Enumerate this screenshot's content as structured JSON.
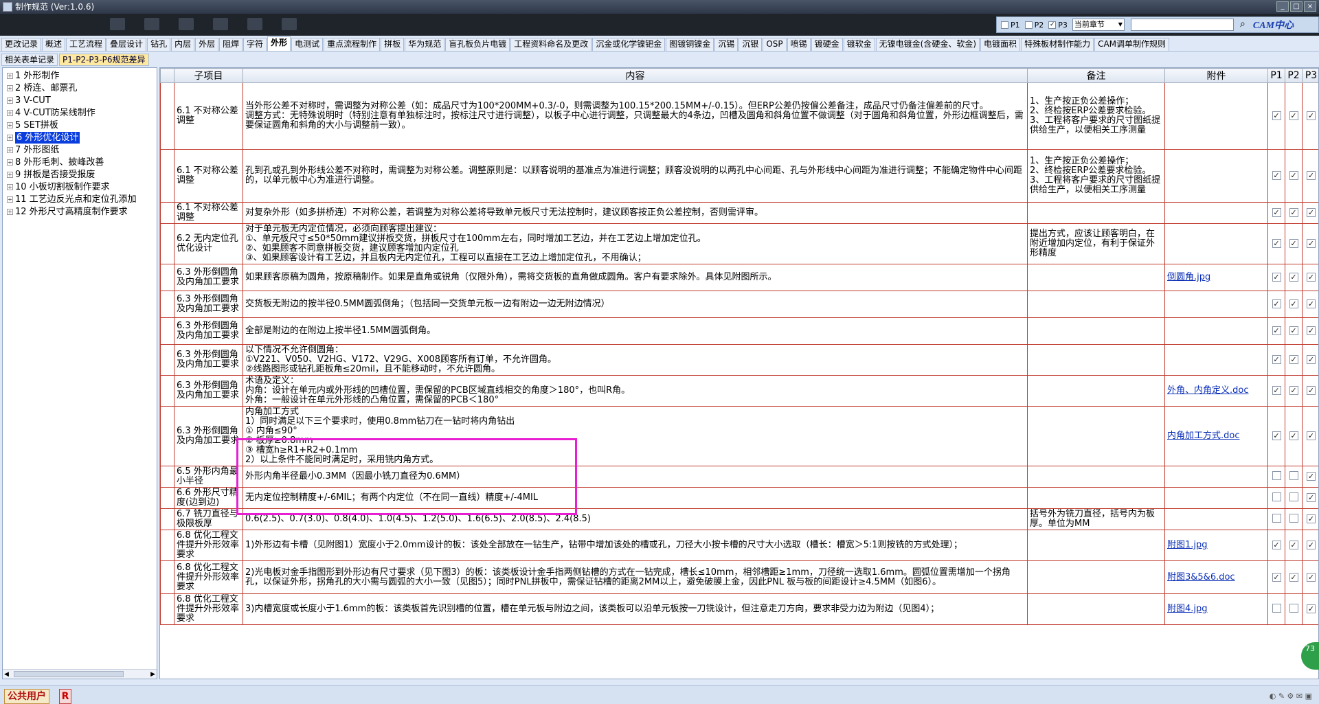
{
  "window": {
    "title": "制作规范 (Ver:1.0.6)"
  },
  "search": {
    "p1_label": "P1",
    "p2_label": "P2",
    "p3_label": "P3",
    "p1_checked": false,
    "p2_checked": false,
    "p3_checked": true,
    "scope": "当前章节",
    "query": "",
    "logo_text": "CAM中心"
  },
  "tabs": [
    "更改记录",
    "概述",
    "工艺流程",
    "叠层设计",
    "钻孔",
    "内层",
    "外层",
    "阻焊",
    "字符",
    "外形",
    "电测试",
    "重点流程制作",
    "拼板",
    "华为规范",
    "盲孔板负片电镀",
    "工程资料命名及更改",
    "沉金或化学镍钯金",
    "图镀铜镍金",
    "沉锡",
    "沉银",
    "OSP",
    "喷锡",
    "镀硬金",
    "镀软金",
    "无镍电镀金(含硬金、软金)",
    "电镀面积",
    "特殊板材制作能力",
    "CAM调单制作规则"
  ],
  "active_tab": "外形",
  "subtabs": [
    "相关表单记录",
    "P1-P2-P3-P6规范差异"
  ],
  "active_subtab": "P1-P2-P3-P6规范差异",
  "tree": [
    "1 外形制作",
    "2 桥连、邮票孔",
    "3 V-CUT",
    "4 V-CUT防呆线制作",
    "5 SET拼板",
    "6 外形优化设计",
    "7 外形图纸",
    "8 外形毛刺、披峰改善",
    "9 拼板是否接受报废",
    "10 小板切割板制作要求",
    "11 工艺边反光点和定位孔添加",
    "12 外形尺寸高精度制作要求"
  ],
  "selected_tree": "6 外形优化设计",
  "columns": {
    "sub": "子项目",
    "content": "内容",
    "note": "备注",
    "attach": "附件",
    "p1": "P1",
    "p2": "P2",
    "p3": "P3"
  },
  "rows": [
    {
      "sub": "6.1 不对称公差调整",
      "content": "当外形公差不对称时，需调整为对称公差（如：成品尺寸为100*200MM+0.3/-0，则需调整为100.15*200.15MM+/-0.15）。但ERP公差仍按偏公差备注，成品尺寸仍备注偏差前的尺寸。\n调整方式：无特殊说明时（特别注意有单独标注时，按标注尺寸进行调整），以板子中心进行调整，只调整最大的4条边，凹槽及圆角和斜角位置不做调整（对于圆角和斜角位置，外形边框调整后，需要保证圆角和斜角的大小与调整前一致）。",
      "note": "1、生产按正负公差操作；\n2、终检按ERP公差要求检验。\n3、工程将客户要求的尺寸图纸提供给生产，以便相关工序测量",
      "attach": "",
      "p1": true,
      "p2": true,
      "p3": true
    },
    {
      "sub": "6.1 不对称公差调整",
      "content": "孔到孔或孔到外形线公差不对称时，需调整为对称公差。调整原则是：以顾客说明的基准点为准进行调整；顾客没说明的以两孔中心间距、孔与外形线中心间距为准进行调整；不能确定物件中心间距的，以单元板中心为准进行调整。",
      "note": "1、生产按正负公差操作；\n2、终检按ERP公差要求检验。\n3、工程将客户要求的尺寸图纸提供给生产，以便相关工序测量",
      "attach": "",
      "p1": true,
      "p2": true,
      "p3": true
    },
    {
      "sub": "6.1 不对称公差调整",
      "content": "对复杂外形（如多拼桥连）不对称公差，若调整为对称公差将导致单元板尺寸无法控制时，建议顾客按正负公差控制，否则需评审。",
      "note": "",
      "attach": "",
      "p1": true,
      "p2": true,
      "p3": true
    },
    {
      "sub": "6.2 无内定位孔优化设计",
      "content": "对于单元板无内定位情况，必须向顾客提出建议：\n①、单元板尺寸≤50*50mm建议拼板交货，拼板尺寸在100mm左右，同时增加工艺边，并在工艺边上增加定位孔。\n②、如果顾客不同意拼板交货，建议顾客增加内定位孔\n③、如果顾客设计有工艺边，并且板内无内定位孔，工程可以直接在工艺边上增加定位孔，不用确认；",
      "note": "提出方式，应该让顾客明白，在附近增加内定位，有利于保证外形精度",
      "attach": "",
      "p1": true,
      "p2": true,
      "p3": true
    },
    {
      "sub": "6.3 外形倒圆角及内角加工要求",
      "content": "如果顾客原稿为圆角，按原稿制作。如果是直角或锐角（仅限外角），需将交货板的直角做成圆角。客户有要求除外。具体见附图所示。",
      "note": "",
      "attach": "倒圆角.jpg",
      "p1": true,
      "p2": true,
      "p3": true
    },
    {
      "sub": "6.3 外形倒圆角及内角加工要求",
      "content": "交货板无附边的按半径0.5MM圆弧倒角；（包括同一交货单元板一边有附边一边无附边情况）",
      "note": "",
      "attach": "",
      "p1": true,
      "p2": true,
      "p3": true
    },
    {
      "sub": "6.3 外形倒圆角及内角加工要求",
      "content": "全部是附边的在附边上按半径1.5MM圆弧倒角。",
      "note": "",
      "attach": "",
      "p1": true,
      "p2": true,
      "p3": true
    },
    {
      "sub": "6.3 外形倒圆角及内角加工要求",
      "content": "以下情况不允许倒圆角：\n①V221、V050、V2HG、V172、V29G、X008顾客所有订单，不允许圆角。\n②线路图形或钻孔距板角≤20mil，且不能移动时，不允许圆角。",
      "note": "",
      "attach": "",
      "p1": true,
      "p2": true,
      "p3": true
    },
    {
      "sub": "6.3 外形倒圆角及内角加工要求",
      "content": "术语及定义：\n内角：设计在单元内或外形线的凹槽位置，需保留的PCB区域直线相交的角度＞180°，也叫R角。\n外角：一般设计在单元外形线的凸角位置，需保留的PCB＜180°",
      "note": "",
      "attach": "外角、内角定义.doc",
      "p1": true,
      "p2": true,
      "p3": true
    },
    {
      "sub": "6.3 外形倒圆角及内角加工要求",
      "content": "内角加工方式\n1）同时满足以下三个要求时，使用0.8mm钻刀在一钻时将内角钻出\n① 内角≤90°\n② 板厚≥0.8mm\n③ 槽宽h≥R1+R2+0.1mm\n2）以上条件不能同时满足时，采用铣内角方式。",
      "note": "",
      "attach": "内角加工方式.doc",
      "p1": true,
      "p2": true,
      "p3": true
    },
    {
      "sub": "6.5 外形内角最小半径",
      "content": "外形内角半径最小0.3MM（因最小铣刀直径为0.6MM）",
      "note": "",
      "attach": "",
      "p1": false,
      "p2": false,
      "p3": true
    },
    {
      "sub": "6.6 外形尺寸精度(边到边)",
      "content": "无内定位控制精度+/-6MIL；有两个内定位（不在同一直线）精度+/-4MIL",
      "note": "",
      "attach": "",
      "p1": false,
      "p2": false,
      "p3": true
    },
    {
      "sub": "6.7 铣刀直径与极限板厚",
      "content": "0.6(2.5)、0.7(3.0)、0.8(4.0)、1.0(4.5)、1.2(5.0)、1.6(6.5)、2.0(8.5)、2.4(8.5)",
      "note": "括号外为铣刀直径，括号内为板厚。单位为MM",
      "attach": "",
      "p1": false,
      "p2": false,
      "p3": true
    },
    {
      "sub": "6.8 优化工程文件提升外形效率要求",
      "content": "1)外形边有卡槽（见附图1）宽度小于2.0mm设计的板：该处全部放在一钻生产，钻带中增加该处的槽或孔，刀径大小按卡槽的尺寸大小选取（槽长：槽宽＞5:1则按铣的方式处理）；",
      "note": "",
      "attach": "附图1.jpg",
      "p1": true,
      "p2": true,
      "p3": true
    },
    {
      "sub": "6.8 优化工程文件提升外形效率要求",
      "content": "2)光电板对金手指图形到外形边有尺寸要求（见下图3）的板：该类板设计金手指两侧钻槽的方式在一钻完成，槽长≤10mm，相邻槽距≥1mm，刀径统一选取1.6mm。圆弧位置需增加一个拐角孔，以保证外形，拐角孔的大小需与圆弧的大小一致（见图5）；同时PNL拼板中，需保证钻槽的距离2MM以上，避免破膜上金，因此PNL 板与板的间距设计≥4.5MM（如图6）。",
      "note": "",
      "attach": "附图3&5&6.doc",
      "p1": true,
      "p2": true,
      "p3": true
    },
    {
      "sub": "6.8 优化工程文件提升外形效率要求",
      "content": "3)内槽宽度或长度小于1.6mm的板：该类板首先识别槽的位置，槽在单元板与附边之间，该类板可以沿单元板按一刀铣设计，但注意走刀方向，要求非受力边为附边（见图4）；",
      "note": "",
      "attach": "附图4.jpg",
      "p1": false,
      "p2": false,
      "p3": true
    }
  ],
  "status": {
    "user": "公共用户",
    "tag": "R",
    "badge": "73"
  }
}
